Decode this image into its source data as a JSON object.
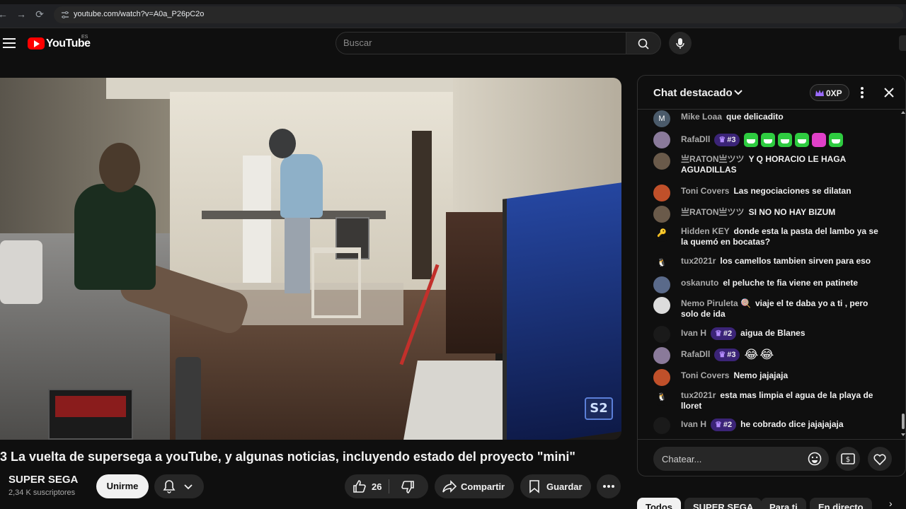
{
  "browser": {
    "url": "youtube.com/watch?v=A0a_P26pC2o"
  },
  "header": {
    "logo_text": "YouTube",
    "logo_region": "ES",
    "search_placeholder": "Buscar"
  },
  "video": {
    "title": "3 La vuelta de supersega a youTube, y algunas noticias, incluyendo estado del proyecto \"mini\"",
    "channel_name": "SUPER SEGA",
    "subscribers": "2,34 K suscriptores",
    "subscribe_label": "Unirme",
    "like_count": "26",
    "share_label": "Compartir",
    "save_label": "Guardar",
    "overlay_logo": "S2"
  },
  "chat": {
    "title": "Chat destacado",
    "xp": "0XP",
    "input_placeholder": "Chatear...",
    "messages": [
      {
        "author": "Mike Loaa",
        "text": "que delicadito",
        "avatar": "M",
        "avatar_color": "#4a5a6a"
      },
      {
        "author": "RafaDll",
        "rank": "#3",
        "text": "",
        "avatar": "",
        "avatar_color": "#8a7a9a",
        "emojis": [
          "green",
          "green",
          "green",
          "green",
          "pink",
          "green"
        ]
      },
      {
        "author": "亗RATON亗ツツ",
        "text": "Y Q HORACIO LE HAGA AGUADILLAS",
        "avatar": "",
        "avatar_color": "#6a5a4a"
      },
      {
        "author": "Toni Covers",
        "text": "Las negociaciones se dilatan",
        "avatar": "",
        "avatar_color": "#c0502a"
      },
      {
        "author": "亗RATON亗ツツ",
        "text": "SI NO NO HAY BIZUM",
        "avatar": "",
        "avatar_color": "#6a5a4a"
      },
      {
        "author": "Hidden KEY",
        "text": "donde esta la pasta del lambo ya se la quemó en bocatas?",
        "avatar": "🔑",
        "avatar_color": "#0f0f0f"
      },
      {
        "author": "tux2021r",
        "text": "los camellos tambien sirven para eso",
        "avatar": "🐧",
        "avatar_color": "#0f0f0f"
      },
      {
        "author": "oskanuto",
        "text": "el peluche te fia viene en patinete",
        "avatar": "",
        "avatar_color": "#5a6a8a"
      },
      {
        "author": "Nemo Piruleta 🍭",
        "text": "viaje el te daba yo a ti , pero solo de ida",
        "avatar": "",
        "avatar_color": "#dcdcdc"
      },
      {
        "author": "Ivan H",
        "rank": "#2",
        "text": "aigua de Blanes",
        "avatar": "",
        "avatar_color": "#1a1a1a"
      },
      {
        "author": "RafaDll",
        "rank": "#3",
        "text": "",
        "avatar": "",
        "avatar_color": "#8a7a9a",
        "laughs": [
          "😂",
          "😂"
        ]
      },
      {
        "author": "Toni Covers",
        "text": "Nemo jajajaja",
        "avatar": "",
        "avatar_color": "#c0502a"
      },
      {
        "author": "tux2021r",
        "text": "esta mas limpia el agua de la playa de lloret",
        "avatar": "🐧",
        "avatar_color": "#0f0f0f"
      },
      {
        "author": "Ivan H",
        "rank": "#2",
        "text": "he cobrado dice jajajajaja",
        "avatar": "",
        "avatar_color": "#1a1a1a"
      }
    ]
  },
  "chips": [
    "Todos",
    "SUPER SEGA",
    "Para ti",
    "En directo"
  ],
  "colors": {
    "background": "#0f0f0f",
    "brand_red": "#ff0000",
    "rank_purple": "#3b2477"
  }
}
